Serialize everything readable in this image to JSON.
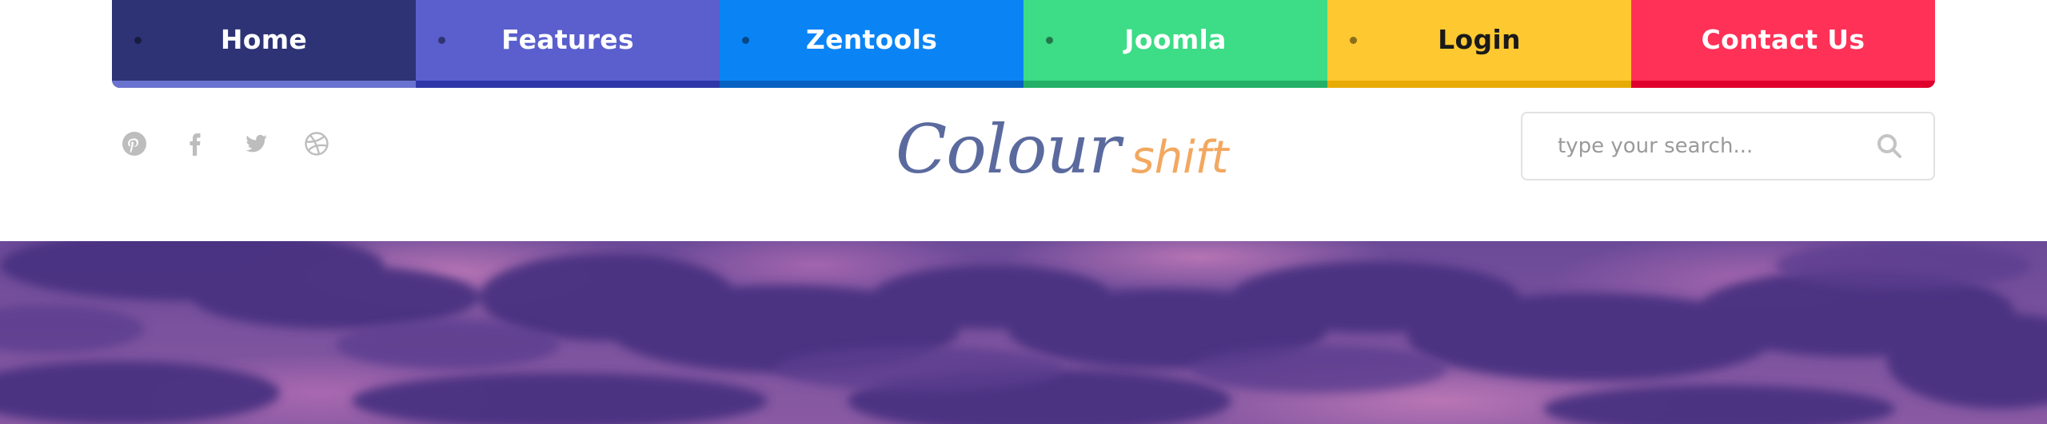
{
  "nav": {
    "items": [
      {
        "label": "Home",
        "bg": "#2d3375",
        "underline": "#6a73cf",
        "text_color": "#ffffff"
      },
      {
        "label": "Features",
        "bg": "#5a5fcd",
        "underline": "#2f37a8",
        "text_color": "#ffffff"
      },
      {
        "label": "Zentools",
        "bg": "#0a84f5",
        "underline": "#0661c2",
        "text_color": "#ffffff"
      },
      {
        "label": "Joomla",
        "bg": "#3ddc86",
        "underline": "#23b066",
        "text_color": "#ffffff"
      },
      {
        "label": "Login",
        "bg": "#fdc830",
        "underline": "#e8aa05",
        "text_color": "#1a1a1a"
      },
      {
        "label": "Contact Us",
        "bg": "#ff3157",
        "underline": "#e0002e",
        "text_color": "#ffffff"
      }
    ]
  },
  "social": {
    "icons": [
      "pinterest-icon",
      "facebook-icon",
      "twitter-icon",
      "dribbble-icon"
    ],
    "color": "#bdbdbd"
  },
  "logo": {
    "main": "Colour",
    "accent": "shift",
    "main_color": "#5b6a9e",
    "accent_color": "#f2a860"
  },
  "search": {
    "placeholder": "type your search...",
    "value": "",
    "icon": "search-icon"
  },
  "hero": {
    "image": "purple-cloudy-sky"
  }
}
